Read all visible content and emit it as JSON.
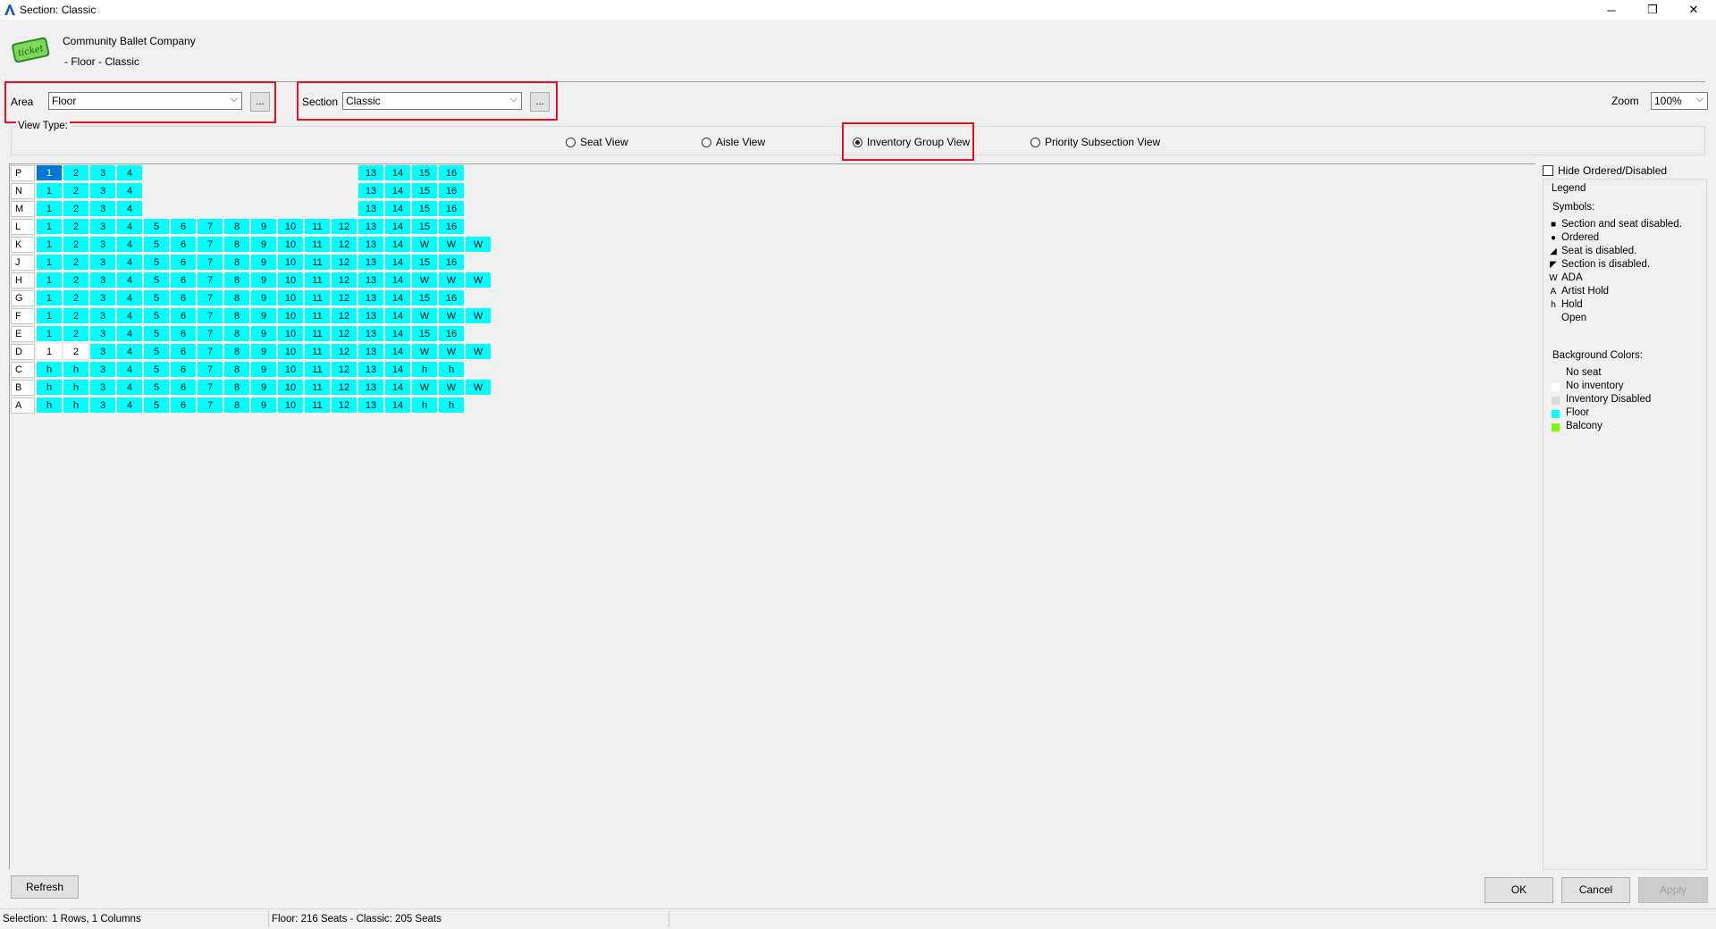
{
  "window": {
    "title": "Section: Classic",
    "minimize": "─",
    "restore": "❐",
    "close": "✕"
  },
  "header": {
    "logo_text": "ticket",
    "company": "Community Ballet Company",
    "subtitle": "- Floor - Classic"
  },
  "area": {
    "label": "Area",
    "value": "Floor",
    "more": "..."
  },
  "section": {
    "label": "Section",
    "value": "Classic",
    "more": "..."
  },
  "zoom": {
    "label": "Zoom",
    "value": "100%"
  },
  "view_type": {
    "label": "View Type:",
    "options": [
      "Seat View",
      "Aisle View",
      "Inventory Group View",
      "Priority Subsection View"
    ],
    "selected": "Inventory Group View"
  },
  "seat_grid": {
    "rows": [
      {
        "label": "P",
        "seats": [
          "1",
          "2",
          "3",
          "4",
          "",
          "",
          "",
          "",
          "",
          "",
          "",
          "",
          "13",
          "14",
          "15",
          "16"
        ]
      },
      {
        "label": "N",
        "seats": [
          "1",
          "2",
          "3",
          "4",
          "",
          "",
          "",
          "",
          "",
          "",
          "",
          "",
          "13",
          "14",
          "15",
          "16"
        ]
      },
      {
        "label": "M",
        "seats": [
          "1",
          "2",
          "3",
          "4",
          "",
          "",
          "",
          "",
          "",
          "",
          "",
          "",
          "13",
          "14",
          "15",
          "16"
        ]
      },
      {
        "label": "L",
        "seats": [
          "1",
          "2",
          "3",
          "4",
          "5",
          "6",
          "7",
          "8",
          "9",
          "10",
          "11",
          "12",
          "13",
          "14",
          "15",
          "16"
        ]
      },
      {
        "label": "K",
        "seats": [
          "1",
          "2",
          "3",
          "4",
          "5",
          "6",
          "7",
          "8",
          "9",
          "10",
          "11",
          "12",
          "13",
          "14",
          "W",
          "W",
          "W"
        ]
      },
      {
        "label": "J",
        "seats": [
          "1",
          "2",
          "3",
          "4",
          "5",
          "6",
          "7",
          "8",
          "9",
          "10",
          "11",
          "12",
          "13",
          "14",
          "15",
          "16"
        ]
      },
      {
        "label": "H",
        "seats": [
          "1",
          "2",
          "3",
          "4",
          "5",
          "6",
          "7",
          "8",
          "9",
          "10",
          "11",
          "12",
          "13",
          "14",
          "W",
          "W",
          "W"
        ]
      },
      {
        "label": "G",
        "seats": [
          "1",
          "2",
          "3",
          "4",
          "5",
          "6",
          "7",
          "8",
          "9",
          "10",
          "11",
          "12",
          "13",
          "14",
          "15",
          "16"
        ]
      },
      {
        "label": "F",
        "seats": [
          "1",
          "2",
          "3",
          "4",
          "5",
          "6",
          "7",
          "8",
          "9",
          "10",
          "11",
          "12",
          "13",
          "14",
          "W",
          "W",
          "W"
        ]
      },
      {
        "label": "E",
        "seats": [
          "1",
          "2",
          "3",
          "4",
          "5",
          "6",
          "7",
          "8",
          "9",
          "10",
          "11",
          "12",
          "13",
          "14",
          "15",
          "16"
        ]
      },
      {
        "label": "D",
        "seats": [
          "1",
          "2",
          "3",
          "4",
          "5",
          "6",
          "7",
          "8",
          "9",
          "10",
          "11",
          "12",
          "13",
          "14",
          "W",
          "W",
          "W"
        ]
      },
      {
        "label": "C",
        "seats": [
          "h",
          "h",
          "3",
          "4",
          "5",
          "6",
          "7",
          "8",
          "9",
          "10",
          "11",
          "12",
          "13",
          "14",
          "h",
          "h"
        ]
      },
      {
        "label": "B",
        "seats": [
          "h",
          "h",
          "3",
          "4",
          "5",
          "6",
          "7",
          "8",
          "9",
          "10",
          "11",
          "12",
          "13",
          "14",
          "W",
          "W",
          "W"
        ]
      },
      {
        "label": "A",
        "seats": [
          "h",
          "h",
          "3",
          "4",
          "5",
          "6",
          "7",
          "8",
          "9",
          "10",
          "11",
          "12",
          "13",
          "14",
          "h",
          "h"
        ]
      }
    ],
    "selected_seat": "P-1",
    "no_inventory_seats": [
      "D-1",
      "D-2"
    ]
  },
  "hide_ordered": {
    "label": "Hide Ordered/Disabled",
    "checked": false
  },
  "legend": {
    "title": "Legend",
    "symbols_title": "Symbols:",
    "symbols": [
      {
        "sym": "■",
        "label": "Section and seat disabled."
      },
      {
        "sym": "●",
        "label": "Ordered"
      },
      {
        "sym": "◢",
        "label": "Seat is disabled."
      },
      {
        "sym": "◤",
        "label": "Section is disabled."
      },
      {
        "sym": "W",
        "label": "ADA"
      },
      {
        "sym": "A",
        "label": "Artist Hold"
      },
      {
        "sym": "h",
        "label": "Hold"
      },
      {
        "sym": "",
        "label": "Open"
      }
    ],
    "bg_title": "Background Colors:",
    "bg_colors": [
      {
        "color": "#f0f0f0",
        "label": "No seat"
      },
      {
        "color": "#ffffff",
        "label": "No inventory"
      },
      {
        "color": "#d9d9d9",
        "label": "Inventory Disabled"
      },
      {
        "color": "#00ffff",
        "label": "Floor"
      },
      {
        "color": "#7cfc00",
        "label": "Balcony"
      }
    ]
  },
  "buttons": {
    "refresh": "Refresh",
    "ok": "OK",
    "cancel": "Cancel",
    "apply": "Apply"
  },
  "status": {
    "selection_label": "Selection:",
    "selection_value": "1 Rows,  1 Columns",
    "counts": "Floor:  216 Seats  -  Classic:  205 Seats"
  },
  "colors": {
    "floor": "#00ffff",
    "selected": "#0078d7",
    "highlight": "#e81123"
  }
}
